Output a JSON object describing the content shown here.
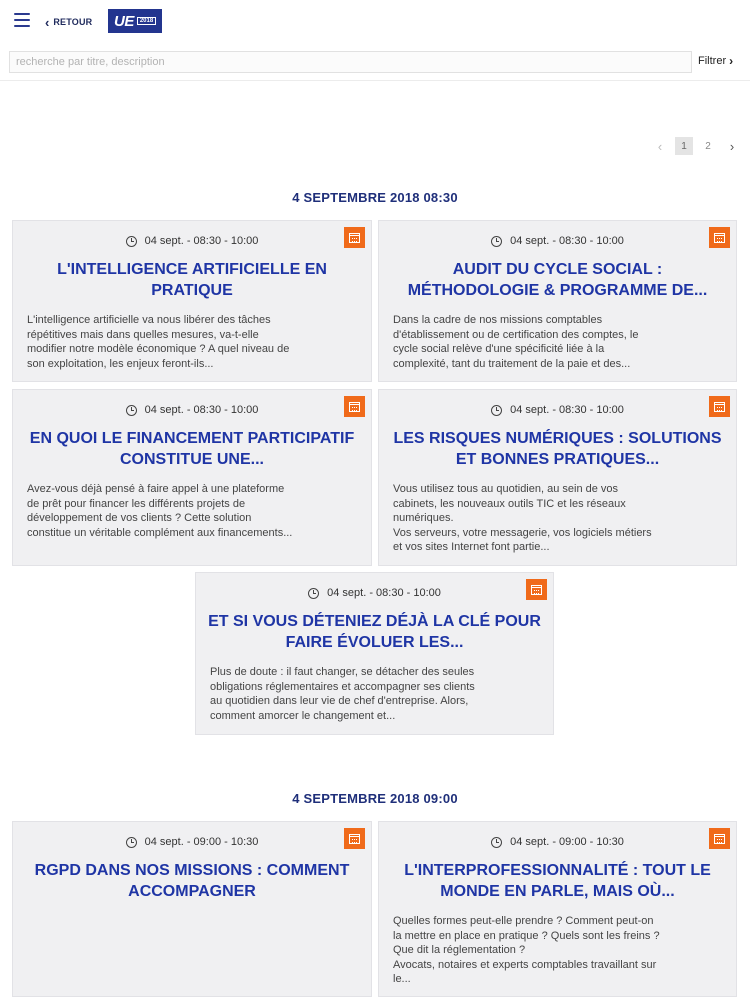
{
  "header": {
    "back_label": "RETOUR",
    "logo_text": "UE",
    "logo_year": "2018"
  },
  "search": {
    "placeholder": "recherche par titre, description",
    "value": "",
    "filter_label": "Filtrer"
  },
  "pagination": {
    "prev": "‹",
    "pages": [
      "1",
      "2"
    ],
    "current": "1",
    "next": "›"
  },
  "sections": [
    {
      "title": "4 SEPTEMBRE 2018 08:30",
      "sessions": [
        {
          "time": "04 sept. - 08:30 - 10:00",
          "title": "L'INTELLIGENCE ARTIFICIELLE EN PRATIQUE",
          "description": "L'intelligence artificielle va nous libérer des tâches\nrépétitives mais dans quelles mesures, va-t-elle\nmodifier notre modèle économique ? A quel niveau de\nson exploitation, les enjeux feront-ils..."
        },
        {
          "time": "04 sept. - 08:30 - 10:00",
          "title": "AUDIT DU CYCLE SOCIAL : MÉTHODOLOGIE & PROGRAMME DE...",
          "description": "Dans la cadre de nos missions comptables\nd'établissement ou de certification des comptes, le\ncycle social relève d'une spécificité liée à la\ncomplexité, tant du traitement de la paie et des..."
        },
        {
          "time": "04 sept. - 08:30 - 10:00",
          "title": "EN QUOI LE FINANCEMENT PARTICIPATIF CONSTITUE UNE...",
          "description": "Avez-vous déjà pensé à faire appel à une plateforme\nde prêt pour financer les différents projets de\ndéveloppement de vos clients ? Cette solution\nconstitue un véritable complément aux financements..."
        },
        {
          "time": "04 sept. - 08:30 - 10:00",
          "title": "LES RISQUES NUMÉRIQUES : SOLUTIONS ET BONNES PRATIQUES...",
          "description": "Vous utilisez tous au quotidien, au sein de vos\ncabinets, les nouveaux outils TIC et les réseaux\nnumériques.\nVos serveurs, votre messagerie, vos logiciels métiers\net vos sites Internet font partie..."
        },
        {
          "time": "04 sept. - 08:30 - 10:00",
          "title": "ET SI VOUS DÉTENIEZ DÉJÀ LA CLÉ POUR FAIRE ÉVOLUER LES...",
          "description": "Plus de doute : il faut changer, se détacher des seules\nobligations réglementaires et accompagner ses clients\nau quotidien dans leur vie de chef d'entreprise. Alors,\ncomment amorcer le changement et..."
        }
      ]
    },
    {
      "title": "4 SEPTEMBRE 2018 09:00",
      "sessions": [
        {
          "time": "04 sept. - 09:00 - 10:30",
          "title": "RGPD DANS NOS MISSIONS : COMMENT ACCOMPAGNER",
          "description": ""
        },
        {
          "time": "04 sept. - 09:00 - 10:30",
          "title": "L'INTERPROFESSIONNALITÉ : TOUT LE MONDE EN PARLE, MAIS OÙ...",
          "description": "Quelles formes peut-elle prendre ? Comment peut-on\nla mettre en place en pratique ? Quels sont les freins ?\nQue dit la réglementation ?\nAvocats, notaires et experts comptables travaillant sur\nle..."
        }
      ]
    }
  ],
  "colors": {
    "accent_blue": "#1f35a5",
    "calendar_orange": "#f06a1a",
    "card_bg": "#f0f0f2"
  }
}
